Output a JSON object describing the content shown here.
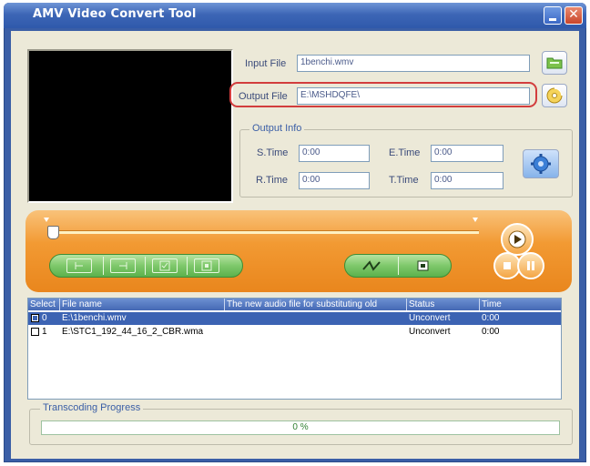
{
  "window": {
    "title": "AMV Video Convert Tool",
    "minimize_icon": "minimize-icon",
    "close_icon": "close-icon",
    "close_glyph": "✕"
  },
  "input_file": {
    "label": "Input File",
    "value": "1benchi.wmv",
    "browse_icon": "folder-icon"
  },
  "output_file": {
    "label": "Output File",
    "value": "E:\\MSHDQFE\\",
    "browse_icon": "disc-folder-icon"
  },
  "output_info": {
    "title": "Output Info",
    "s_time": {
      "label": "S.Time",
      "value": "0:00"
    },
    "e_time": {
      "label": "E.Time",
      "value": "0:00"
    },
    "r_time": {
      "label": "R.Time",
      "value": "0:00"
    },
    "t_time": {
      "label": "T.Time",
      "value": "0:00"
    },
    "settings_icon": "gear-icon"
  },
  "player": {
    "play_icon": "play-icon",
    "pause_icon": "pause-icon",
    "stop_icon": "stop-icon",
    "controls_left": [
      "mark-start-icon",
      "mark-end-icon",
      "checkbox-icon",
      "select-icon"
    ],
    "controls_right": [
      "wave-icon",
      "stop-square-icon"
    ]
  },
  "file_list": {
    "columns": [
      "Select",
      "File name",
      "The new audio file for substituting old",
      "Status",
      "Time"
    ],
    "rows": [
      {
        "index": "0",
        "checked": true,
        "name": "E:\\1benchi.wmv",
        "audio": "",
        "status": "Unconvert",
        "time": "0:00"
      },
      {
        "index": "1",
        "checked": false,
        "name": "E:\\STC1_192_44_16_2_CBR.wma",
        "audio": "",
        "status": "Unconvert",
        "time": "0:00"
      }
    ]
  },
  "progress": {
    "title": "Transcoding Progress",
    "value": 0,
    "label": "0 %"
  },
  "colors": {
    "accent": "#3a5ea6",
    "orange": "#f29a33",
    "green": "#7ec86b",
    "highlight": "#d23d3d"
  }
}
